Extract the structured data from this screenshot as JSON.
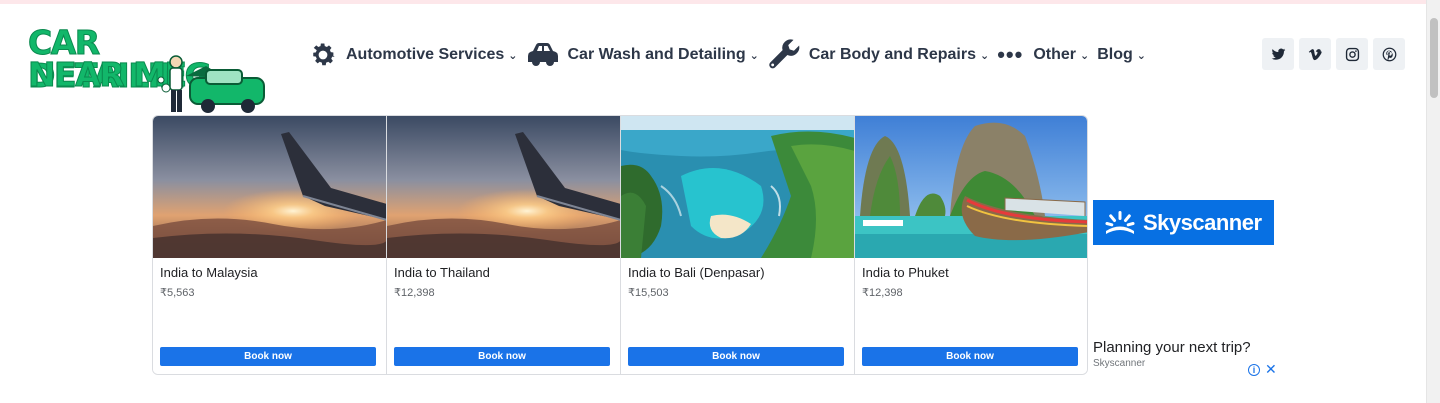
{
  "logo": {
    "line1": "CAR DETAILING",
    "line2": "NEAR ME"
  },
  "nav": {
    "items": [
      {
        "label": "Automotive Services",
        "icon": "gear-icon"
      },
      {
        "label": "Car Wash and Detailing",
        "icon": "car-icon"
      },
      {
        "label": "Car Body and Repairs",
        "icon": "wrench-icon"
      },
      {
        "label": "Other",
        "icon": "more-dots-icon"
      },
      {
        "label": "Blog",
        "icon": ""
      }
    ]
  },
  "socials": [
    "twitter-icon",
    "vimeo-icon",
    "instagram-icon",
    "pinterest-icon"
  ],
  "ad": {
    "cards": [
      {
        "destination": "India to Malaysia",
        "price": "₹5,563",
        "button": "Book now"
      },
      {
        "destination": "India to Thailand",
        "price": "₹12,398",
        "button": "Book now"
      },
      {
        "destination": "India to Bali (Denpasar)",
        "price": "₹15,503",
        "button": "Book now"
      },
      {
        "destination": "India to Phuket",
        "price": "₹12,398",
        "button": "Book now"
      }
    ],
    "brand": "Skyscanner",
    "headline": "Planning your next trip?",
    "advertiser": "Skyscanner"
  },
  "colors": {
    "brand_green": "#12b76a",
    "nav_text": "#2d3748",
    "button_blue": "#1a73e8",
    "skyscanner_blue": "#0770e3"
  }
}
